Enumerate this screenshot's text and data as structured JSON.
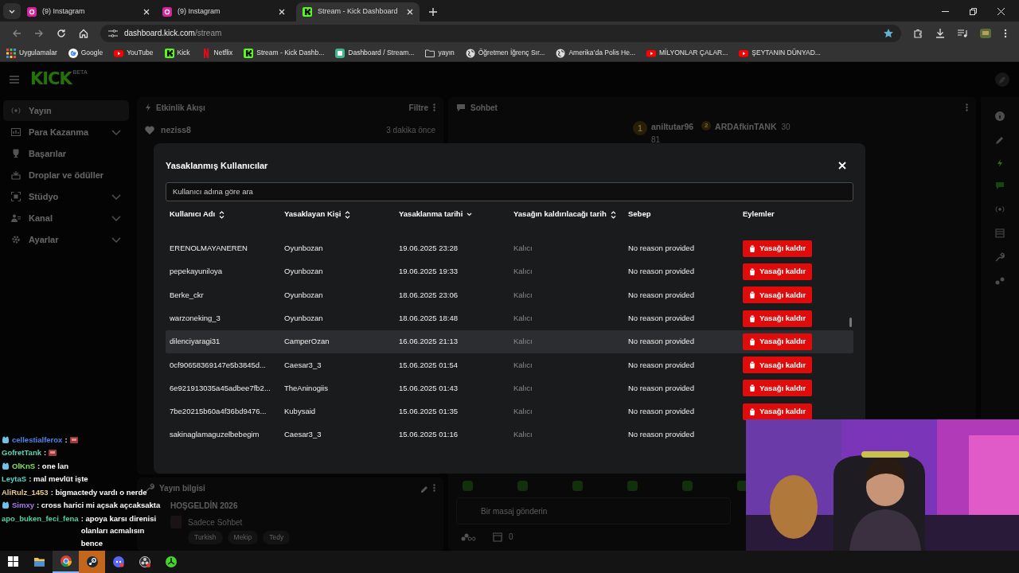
{
  "browser": {
    "tabs": [
      {
        "title": "(9) Instagram",
        "kind": "instagram",
        "selected": false
      },
      {
        "title": "(9) Instagram",
        "kind": "instagram",
        "selected": false
      },
      {
        "title": "Stream - Kick Dashboard",
        "kind": "kick",
        "selected": true
      }
    ],
    "address": {
      "host": "dashboard.kick.com",
      "path": "/stream"
    },
    "bookmarks": [
      {
        "label": "Uygulamalar",
        "kind": "apps"
      },
      {
        "label": "Google",
        "kind": "google"
      },
      {
        "label": "YouTube",
        "kind": "youtube"
      },
      {
        "label": "Kick",
        "kind": "kick"
      },
      {
        "label": "Netflix",
        "kind": "netflix"
      },
      {
        "label": "Stream - Kick Dashb...",
        "kind": "kick"
      },
      {
        "label": "Dashboard / Stream...",
        "kind": "dash"
      },
      {
        "label": "yayın",
        "kind": "folder"
      },
      {
        "label": "Öğretmen İğrenç Sır...",
        "kind": "globe"
      },
      {
        "label": "Amerika’da Polis He...",
        "kind": "globe"
      },
      {
        "label": "MİLYONLAR ÇALAR...",
        "kind": "youtube"
      },
      {
        "label": "ŞEYTANIN DÜNYAD...",
        "kind": "youtube"
      }
    ]
  },
  "dashboard": {
    "logo": "KICK",
    "logo_badge": "BETA",
    "sidebar": [
      {
        "label": "Yayın",
        "kind": "stream",
        "expandable": false,
        "selected": true
      },
      {
        "label": "Para Kazanma",
        "kind": "money",
        "expandable": true,
        "selected": false
      },
      {
        "label": "Başarılar",
        "kind": "trophy",
        "expandable": false,
        "selected": false
      },
      {
        "label": "Droplar ve ödüller",
        "kind": "gift",
        "expandable": false,
        "selected": false
      },
      {
        "label": "Stüdyo",
        "kind": "studio",
        "expandable": true,
        "selected": false
      },
      {
        "label": "Kanal",
        "kind": "users",
        "expandable": true,
        "selected": false
      },
      {
        "label": "Ayarlar",
        "kind": "gear",
        "expandable": true,
        "selected": false
      }
    ],
    "activity": {
      "title": "Etkinlik Akışı",
      "filter": "Filtre",
      "events": [
        {
          "user": "neziss8",
          "time": "3 dakika önce"
        }
      ]
    },
    "chat": {
      "title": "Sohbet",
      "leaders": [
        {
          "rank": "1",
          "user": "aniltutar96",
          "count": "81"
        },
        {
          "rank": "2",
          "user": "ARDAfkinTANK",
          "count": "30"
        }
      ],
      "placeholder": "Bir masaj gönderin",
      "points": "0"
    },
    "stream_info": {
      "title": "Yayın bilgisi",
      "stream_title": "HOŞGELDİN 2026",
      "category": "Sadece Sohbet",
      "tags": [
        "Turkish",
        "Mekip",
        "Tedy"
      ]
    }
  },
  "modal": {
    "title": "Yasaklanmış Kullanıcılar",
    "search": {
      "placeholder": "Kullanıcı adına göre ara"
    },
    "columns": [
      {
        "label": "Kullanıcı Adı",
        "sortable": true,
        "sorted": false
      },
      {
        "label": "Yasaklayan Kişi",
        "sortable": true,
        "sorted": false
      },
      {
        "label": "Yasaklanma tarihi",
        "sortable": true,
        "sorted": true
      },
      {
        "label": "Yasağın kaldırılacağı tarih",
        "sortable": true,
        "sorted": false
      },
      {
        "label": "Sebep",
        "sortable": false,
        "sorted": false
      },
      {
        "label": "Eylemler",
        "sortable": false,
        "sorted": false
      }
    ],
    "rows": [
      {
        "user": "ERENOLMAYANEREN",
        "banned_by": "Oyunbozan",
        "date": "19.06.2025 23:28",
        "until": "Kalıcı",
        "reason": "No reason provided",
        "action": "Yasağı kaldır",
        "hovered": false
      },
      {
        "user": "pepekayuniloya",
        "banned_by": "Oyunbozan",
        "date": "19.06.2025 19:33",
        "until": "Kalıcı",
        "reason": "No reason provided",
        "action": "Yasağı kaldır",
        "hovered": false
      },
      {
        "user": "Berke_ckr",
        "banned_by": "Oyunbozan",
        "date": "18.06.2025 23:06",
        "until": "Kalıcı",
        "reason": "No reason provided",
        "action": "Yasağı kaldır",
        "hovered": false
      },
      {
        "user": "warzoneking_3",
        "banned_by": "Oyunbozan",
        "date": "18.06.2025 18:48",
        "until": "Kalıcı",
        "reason": "No reason provided",
        "action": "Yasağı kaldır",
        "hovered": false
      },
      {
        "user": "dilenciyaragi31",
        "banned_by": "CamperOzan",
        "date": "16.06.2025 21:13",
        "until": "Kalıcı",
        "reason": "No reason provided",
        "action": "Yasağı kaldır",
        "hovered": true
      },
      {
        "user": "0cf90658369147e5b3845d...",
        "banned_by": "Caesar3_3",
        "date": "15.06.2025 01:54",
        "until": "Kalıcı",
        "reason": "No reason provided",
        "action": "Yasağı kaldır",
        "hovered": false
      },
      {
        "user": "6e921913035a45adbee7fb2...",
        "banned_by": "TheAninogiis",
        "date": "15.06.2025 01:43",
        "until": "Kalıcı",
        "reason": "No reason provided",
        "action": "Yasağı kaldır",
        "hovered": false
      },
      {
        "user": "7be20215b60a4f36bd9476...",
        "banned_by": "Kubysaid",
        "date": "15.06.2025 01:35",
        "until": "Kalıcı",
        "reason": "No reason provided",
        "action": "Yasağı kaldır",
        "hovered": false
      },
      {
        "user": "sakinaglamaguzelbebegim",
        "banned_by": "Caesar3_3",
        "date": "15.06.2025 01:16",
        "until": "Kalıcı",
        "reason": "No reason provided",
        "hovered": false
      }
    ]
  },
  "overlay_chat": [
    {
      "name": "cellestialferox",
      "color": "#4a86e8",
      "badge": true,
      "emote": true,
      "text": ":"
    },
    {
      "name": "GofretTank",
      "color": "#5fd3b3",
      "badge": false,
      "emote": true,
      "text": ":"
    },
    {
      "name": "OlKnS",
      "color": "#86e35a",
      "badge": true,
      "emote": false,
      "text": ": one lan"
    },
    {
      "name": "LeytaS",
      "color": "#56d4c4",
      "badge": false,
      "emote": false,
      "text": ": mal mevlüt işte"
    },
    {
      "name": "AliRulz_1453",
      "color": "#e8c98a",
      "badge": false,
      "emote": false,
      "text": ": bigmactedy vardı o nerde"
    },
    {
      "name": "Simxy",
      "color": "#a97cf2",
      "badge": true,
      "emote": false,
      "text": ": cross harici mi açsak açcaksakta"
    },
    {
      "name": "apo_buken_feci_fena",
      "color": "#4fd1a8",
      "badge": false,
      "emote": false,
      "text": ": apoya karsı direnisi olanları acmalısın bence"
    }
  ],
  "taskbar": [
    {
      "kind": "windows",
      "active": false,
      "attention": false
    },
    {
      "kind": "explorer",
      "active": false,
      "attention": false
    },
    {
      "kind": "chrome",
      "active": true,
      "attention": false
    },
    {
      "kind": "steam",
      "active": false,
      "attention": true
    },
    {
      "kind": "discord",
      "active": false,
      "attention": false
    },
    {
      "kind": "obs",
      "active": false,
      "attention": false
    },
    {
      "kind": "razer",
      "active": false,
      "attention": false
    }
  ]
}
